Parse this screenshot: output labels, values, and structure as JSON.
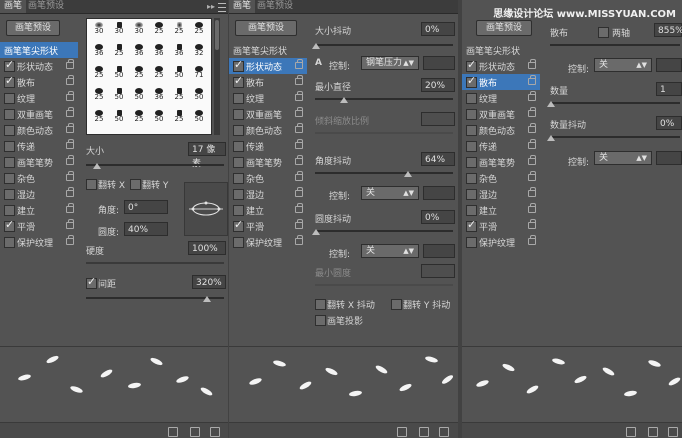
{
  "watermark": "思缘设计论坛 www.MISSYUAN.COM",
  "panel1": {
    "tabs": [
      "画笔",
      "画笔预设"
    ],
    "preset_button": "画笔预设",
    "list": [
      {
        "label": "画笔笔尖形状",
        "checked": false,
        "selected": true,
        "head": true
      },
      {
        "label": "形状动态",
        "checked": true
      },
      {
        "label": "散布",
        "checked": true
      },
      {
        "label": "纹理",
        "checked": false
      },
      {
        "label": "双重画笔",
        "checked": false
      },
      {
        "label": "颜色动态",
        "checked": false
      },
      {
        "label": "传递",
        "checked": false
      },
      {
        "label": "画笔笔势",
        "checked": false
      },
      {
        "label": "杂色",
        "checked": false
      },
      {
        "label": "湿边",
        "checked": false
      },
      {
        "label": "建立",
        "checked": false
      },
      {
        "label": "平滑",
        "checked": true
      },
      {
        "label": "保护纹理",
        "checked": false
      }
    ],
    "brush_sizes": [
      "30",
      "30",
      "30",
      "25",
      "25",
      "25",
      "36",
      "25",
      "36",
      "36",
      "36",
      "32",
      "25",
      "50",
      "25",
      "25",
      "50",
      "71",
      "25",
      "50",
      "50",
      "36",
      "25",
      "50",
      "25",
      "50",
      "25",
      "50",
      "25",
      "50"
    ],
    "size_label": "大小",
    "size_value": "17 像素",
    "flip_x": "翻转 X",
    "flip_y": "翻转 Y",
    "angle_label": "角度:",
    "angle_value": "0°",
    "roundness_label": "圆度:",
    "roundness_value": "40%",
    "hardness_label": "硬度",
    "hardness_value": "100%",
    "spacing_label": "间距",
    "spacing_value": "320%"
  },
  "panel2": {
    "tabs": [
      "画笔",
      "画笔预设"
    ],
    "preset_button": "画笔预设",
    "list": [
      {
        "label": "画笔笔尖形状",
        "checked": false,
        "head": true
      },
      {
        "label": "形状动态",
        "checked": true,
        "selected": true
      },
      {
        "label": "散布",
        "checked": true
      },
      {
        "label": "纹理",
        "checked": false
      },
      {
        "label": "双重画笔",
        "checked": false
      },
      {
        "label": "颜色动态",
        "checked": false
      },
      {
        "label": "传递",
        "checked": false
      },
      {
        "label": "画笔笔势",
        "checked": false
      },
      {
        "label": "杂色",
        "checked": false
      },
      {
        "label": "湿边",
        "checked": false
      },
      {
        "label": "建立",
        "checked": false
      },
      {
        "label": "平滑",
        "checked": true
      },
      {
        "label": "保护纹理",
        "checked": false
      }
    ],
    "size_jitter_label": "大小抖动",
    "size_jitter_value": "0%",
    "control_label": "控制:",
    "control1_value": "钢笔压力",
    "min_diameter_label": "最小直径",
    "min_diameter_value": "20%",
    "tilt_scale_label": "倾斜缩放比例",
    "angle_jitter_label": "角度抖动",
    "angle_jitter_value": "64%",
    "control2_value": "关",
    "roundness_jitter_label": "圆度抖动",
    "roundness_jitter_value": "0%",
    "control3_value": "关",
    "min_roundness_label": "最小圆度",
    "flip_x_jitter": "翻转 X 抖动",
    "flip_y_jitter": "翻转 Y 抖动",
    "brush_projection": "画笔投影"
  },
  "panel3": {
    "preset_button": "画笔预设",
    "list": [
      {
        "label": "画笔笔尖形状",
        "checked": false,
        "head": true
      },
      {
        "label": "形状动态",
        "checked": true
      },
      {
        "label": "散布",
        "checked": true,
        "selected": true
      },
      {
        "label": "纹理",
        "checked": false
      },
      {
        "label": "双重画笔",
        "checked": false
      },
      {
        "label": "颜色动态",
        "checked": false
      },
      {
        "label": "传递",
        "checked": false
      },
      {
        "label": "画笔笔势",
        "checked": false
      },
      {
        "label": "杂色",
        "checked": false
      },
      {
        "label": "湿边",
        "checked": false
      },
      {
        "label": "建立",
        "checked": false
      },
      {
        "label": "平滑",
        "checked": true
      },
      {
        "label": "保护纹理",
        "checked": false
      }
    ],
    "scatter_label": "散布",
    "both_axes_label": "两轴",
    "scatter_value": "855%",
    "control_label": "控制:",
    "control1_value": "关",
    "count_label": "数量",
    "count_value": "1",
    "count_jitter_label": "数量抖动",
    "count_jitter_value": "0%",
    "control2_value": "关"
  }
}
